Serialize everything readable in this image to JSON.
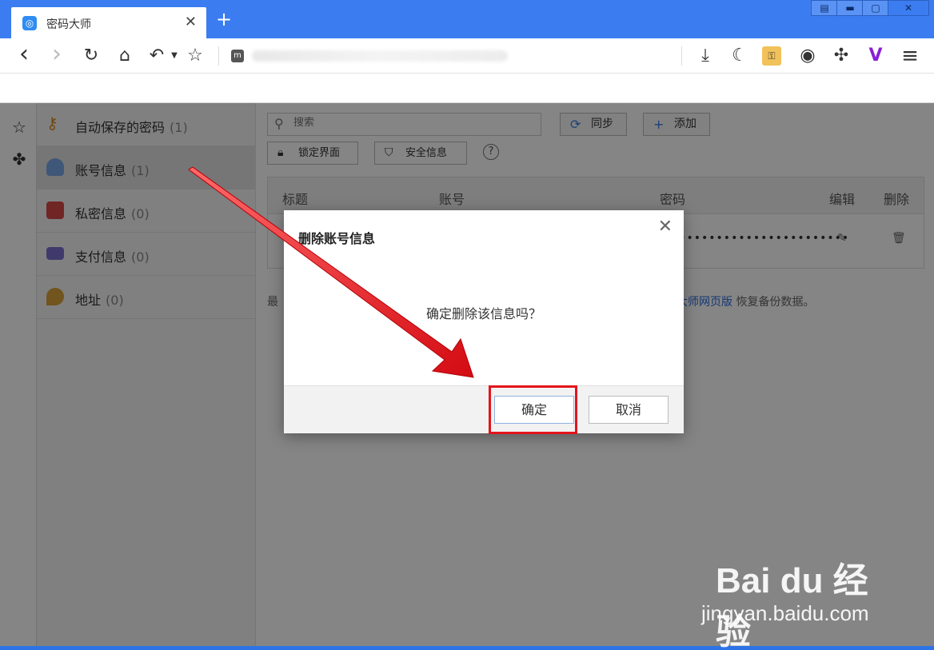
{
  "tab": {
    "title": "密码大师",
    "close": "✕",
    "new_tab": "+"
  },
  "window_controls": {
    "layout": "▤",
    "minimize": "▬",
    "restore": "▢",
    "close": "✕"
  },
  "toolbar": {
    "back": "‹",
    "forward": "›",
    "reload": "↻",
    "home": "⌂",
    "undo": "↶",
    "star": "☆",
    "download": "⤓",
    "night": "☾",
    "screenshot": "◉",
    "extensions": "✣",
    "menu": "≡"
  },
  "sidebar": {
    "items": [
      {
        "label": "自动保存的密码",
        "count": "(1)",
        "color": "#d9891e"
      },
      {
        "label": "账号信息",
        "count": "(1)",
        "color": "#4a8ad8"
      },
      {
        "label": "私密信息",
        "count": "(0)",
        "color": "#d84a4a"
      },
      {
        "label": "支付信息",
        "count": "(0)",
        "color": "#7c6fd0"
      },
      {
        "label": "地址",
        "count": "(0)",
        "color": "#d9a13a"
      }
    ]
  },
  "main": {
    "search_placeholder": "搜索",
    "sync_label": "同步",
    "add_label": "添加",
    "lock_label": "锁定界面",
    "security_label": "安全信息",
    "help": "?",
    "columns": [
      "标题",
      "账号",
      "密码",
      "编辑",
      "删除"
    ],
    "row": {
      "password": "••••••••••••••••••••••••",
      "edit_icon": "✎",
      "delete_icon": "🗑"
    },
    "hint_prefix": "最",
    "hint_link": "大师网页版",
    "hint_suffix": "恢复备份数据。"
  },
  "dialog": {
    "title": "删除账号信息",
    "close": "✕",
    "message": "确定删除该信息吗？",
    "ok_label": "确定",
    "cancel_label": "取消"
  },
  "watermark": {
    "brand": "Bai du 经验",
    "url": "jingyan.baidu.com"
  },
  "colors": {
    "accent": "#2e73e6",
    "highlight": "#e4141b",
    "arrow": "#e4141b"
  }
}
